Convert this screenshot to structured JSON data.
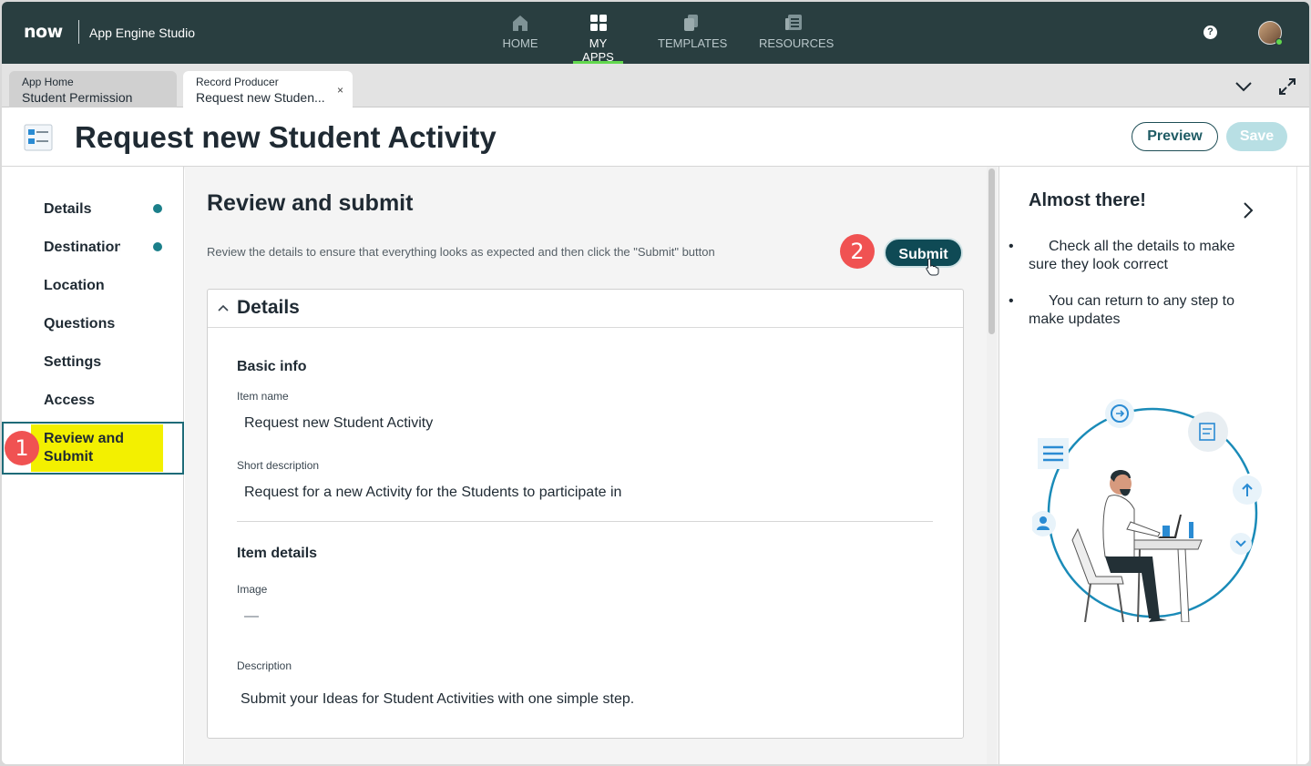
{
  "topnav": {
    "logo": "now",
    "app_name": "App Engine Studio",
    "items": [
      {
        "label": "HOME",
        "icon": "home-icon"
      },
      {
        "label": "MY APPS",
        "icon": "grid-icon",
        "active": true
      },
      {
        "label": "TEMPLATES",
        "icon": "templates-icon"
      },
      {
        "label": "RESOURCES",
        "icon": "resources-icon"
      }
    ],
    "help": "?"
  },
  "tabs": [
    {
      "type": "App Home",
      "title": "Student Permission"
    },
    {
      "type": "Record Producer",
      "title": "Request new Studen...",
      "close": "×"
    }
  ],
  "header": {
    "title": "Request new Student Activity",
    "preview_label": "Preview",
    "save_label": "Save"
  },
  "steps": {
    "items": [
      {
        "label": "Details",
        "complete": true
      },
      {
        "label": "Destination",
        "complete": true
      },
      {
        "label": "Location"
      },
      {
        "label": "Questions"
      },
      {
        "label": "Settings"
      },
      {
        "label": "Access"
      }
    ],
    "active_label": "Review and Submit"
  },
  "badges": {
    "one": "1",
    "two": "2"
  },
  "main": {
    "title": "Review and submit",
    "description": "Review the details to ensure that everything looks as expected and then click the \"Submit\" button",
    "submit_label": "Submit",
    "card": {
      "title": "Details",
      "basic_info": "Basic info",
      "item_name_label": "Item name",
      "item_name_value": "Request new Student Activity",
      "short_desc_label": "Short description",
      "short_desc_value": "Request for a new Activity for the Students to participate in",
      "item_details": "Item details",
      "image_label": "Image",
      "image_value": "—",
      "description_label": "Description",
      "description_value": "Submit your Ideas for Student Activities with one simple step."
    }
  },
  "right_panel": {
    "title": "Almost there!",
    "tips": [
      "Check all the details to make sure they look correct",
      "You can return to any step to make updates"
    ]
  },
  "colors": {
    "nav_bg": "#293e40",
    "accent": "#0f4a55",
    "highlight": "#f3f000",
    "badge": "#f05252",
    "active_underline": "#62d84e"
  }
}
